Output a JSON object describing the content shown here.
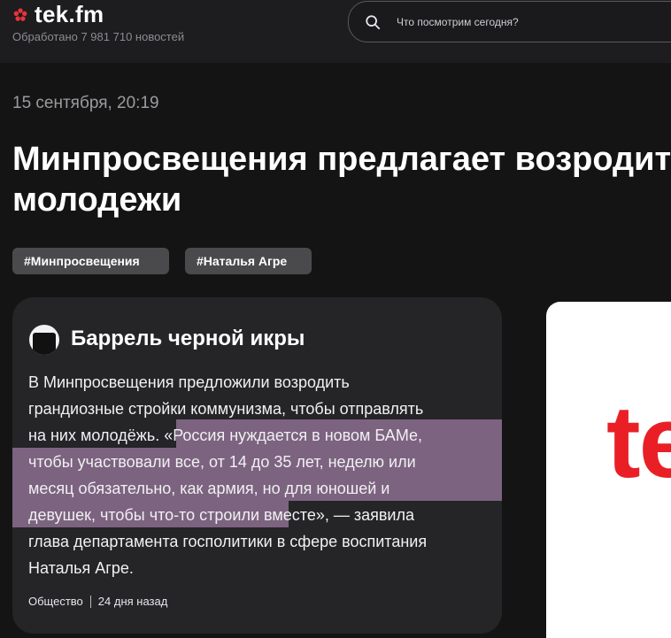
{
  "header": {
    "logo_text": "tek.fm",
    "processed_text": "Обработано 7 981 710 новостей",
    "search_placeholder": "Что посмотрим сегодня?"
  },
  "article": {
    "date": "15 сентября, 20:19",
    "title_line1": "Минпросвещения предлагает возродить",
    "title_line2": "молодежи",
    "tags": [
      "#Минпросвещения",
      "#Наталья Агре"
    ]
  },
  "card": {
    "source_name": "Баррель черной икры",
    "body_lines": [
      "В Минпросвещения предложили возродить",
      "грандиозные стройки коммунизма, чтобы отправлять",
      "на них молодёжь. «Россия нуждается в новом БАМе,",
      "чтобы участвовали все, от 14 до 35 лет, неделю или",
      "месяц обязательно, как армия, но для юношей и",
      "девушек, чтобы что-то строили вместе», — заявила",
      "глава департамента госполитики в сфере воспитания",
      "Наталья Агре."
    ],
    "category": "Общество",
    "time_ago": "24 дня назад"
  },
  "image": {
    "logo_letters": "te"
  },
  "colors": {
    "background": "#151415",
    "card": "#252427",
    "highlight": "#7c6380",
    "brand_red": "#ea1f26"
  }
}
